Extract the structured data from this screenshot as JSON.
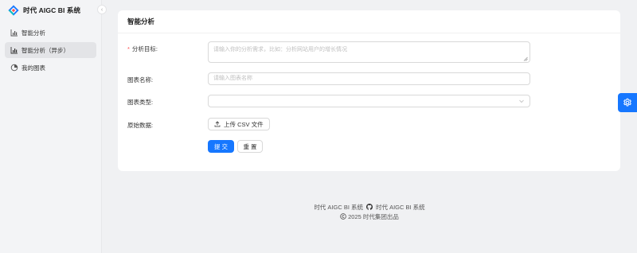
{
  "app": {
    "title": "时代 AIGC BI 系统",
    "brand_colors": [
      "#1677ff",
      "#ff4d4f",
      "#13c2c2"
    ]
  },
  "sidebar": {
    "collapse_icon": "chevron-left-icon",
    "items": [
      {
        "label": "智能分析",
        "icon": "bar-chart-icon",
        "active": false
      },
      {
        "label": "智能分析（异步）",
        "icon": "bar-chart-icon",
        "active": true
      },
      {
        "label": "我的图表",
        "icon": "pie-chart-icon",
        "active": false
      }
    ]
  },
  "card": {
    "title": "智能分析"
  },
  "form": {
    "goal": {
      "label": "分析目标:",
      "required": true,
      "placeholder": "请输入你的分析需求，比如：分析网站用户的增长情况"
    },
    "chart_name": {
      "label": "图表名称:",
      "placeholder": "请输入图表名称"
    },
    "chart_type": {
      "label": "图表类型:",
      "value": ""
    },
    "raw_data": {
      "label": "原始数据:",
      "upload_label": "上传 CSV 文件"
    },
    "submit_label": "提 交",
    "reset_label": "重 置"
  },
  "footer": {
    "left_text": "时代 AIGC BI 系统",
    "right_text": "时代 AIGC BI 系统",
    "copyright": "2025 时代集团出品"
  },
  "colors": {
    "primary": "#1677ff",
    "required": "#ff4d4f"
  }
}
